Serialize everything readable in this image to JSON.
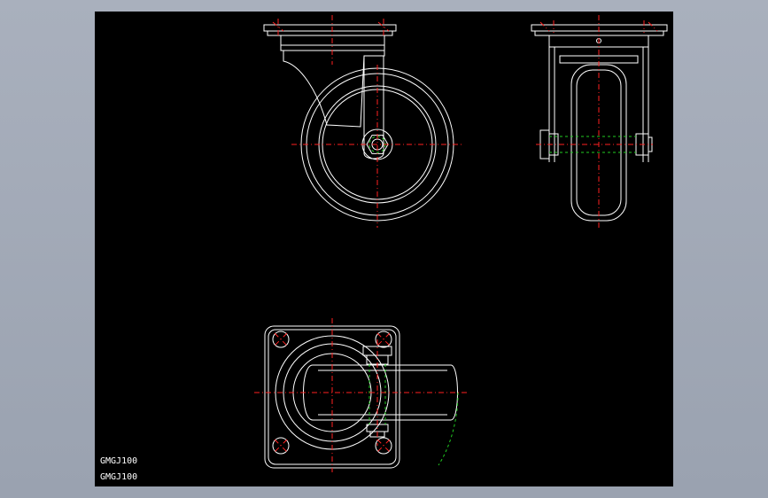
{
  "drawing": {
    "labels": [
      "GMGJ100",
      "GMGJ100"
    ],
    "colors": {
      "background": "#000000",
      "outline": "#ffffff",
      "centerline": "#ff2020",
      "hidden_line": "#22cc22",
      "frame": "#9aa2b0"
    }
  }
}
